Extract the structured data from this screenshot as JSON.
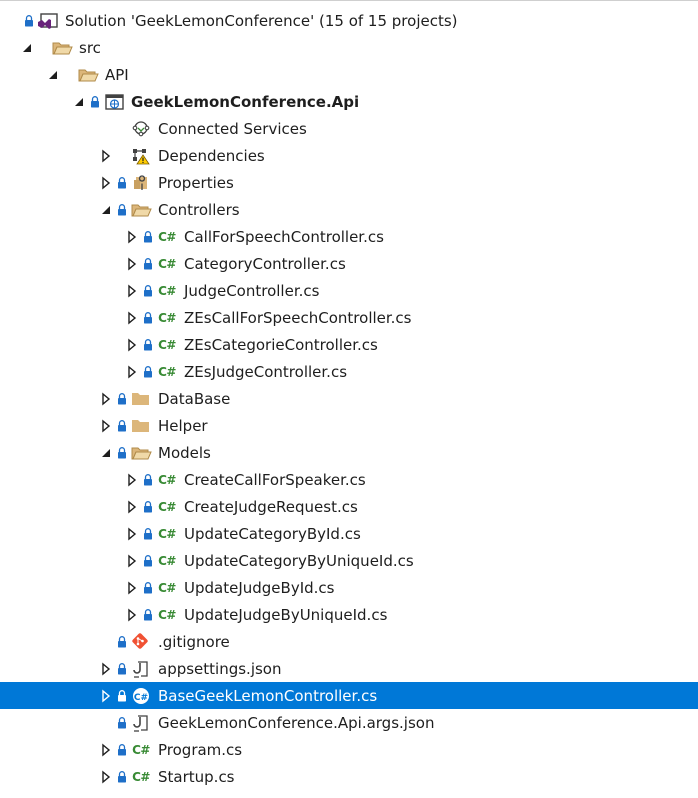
{
  "colors": {
    "selection": "#0078d7",
    "folder_fill": "#dcb67a",
    "csharp_green": "#388a34",
    "lock_blue": "#1e6fc8",
    "git_red": "#f05133",
    "solution_purple": "#68217a"
  },
  "csharp_glyph": "C#",
  "tree": [
    {
      "label": "Solution 'GeekLemonConference' (15 of 15 projects)",
      "level": 0,
      "expander": "none",
      "lock": true,
      "icon": "solution-icon"
    },
    {
      "label": "src",
      "level": 1,
      "expander": "expanded",
      "lock": false,
      "icon": "folder-open-icon"
    },
    {
      "label": "API",
      "level": 2,
      "expander": "expanded",
      "lock": false,
      "icon": "folder-open-icon"
    },
    {
      "label": "GeekLemonConference.Api",
      "level": 3,
      "expander": "expanded",
      "lock": true,
      "icon": "web-project-icon",
      "bold": true
    },
    {
      "label": "Connected Services",
      "level": 4,
      "expander": "none",
      "lock": false,
      "icon": "connected-services-icon"
    },
    {
      "label": "Dependencies",
      "level": 4,
      "expander": "collapsed",
      "lock": false,
      "icon": "dependencies-icon"
    },
    {
      "label": "Properties",
      "level": 4,
      "expander": "collapsed",
      "lock": true,
      "icon": "properties-icon"
    },
    {
      "label": "Controllers",
      "level": 4,
      "expander": "expanded",
      "lock": true,
      "icon": "folder-open-icon"
    },
    {
      "label": "CallForSpeechController.cs",
      "level": 5,
      "expander": "collapsed",
      "lock": true,
      "icon": "csharp-file-icon"
    },
    {
      "label": "CategoryController.cs",
      "level": 5,
      "expander": "collapsed",
      "lock": true,
      "icon": "csharp-file-icon"
    },
    {
      "label": "JudgeController.cs",
      "level": 5,
      "expander": "collapsed",
      "lock": true,
      "icon": "csharp-file-icon"
    },
    {
      "label": "ZEsCallForSpeechController.cs",
      "level": 5,
      "expander": "collapsed",
      "lock": true,
      "icon": "csharp-file-icon"
    },
    {
      "label": "ZEsCategorieController.cs",
      "level": 5,
      "expander": "collapsed",
      "lock": true,
      "icon": "csharp-file-icon"
    },
    {
      "label": "ZEsJudgeController.cs",
      "level": 5,
      "expander": "collapsed",
      "lock": true,
      "icon": "csharp-file-icon"
    },
    {
      "label": "DataBase",
      "level": 4,
      "expander": "collapsed",
      "lock": true,
      "icon": "folder-closed-icon"
    },
    {
      "label": "Helper",
      "level": 4,
      "expander": "collapsed",
      "lock": true,
      "icon": "folder-closed-icon"
    },
    {
      "label": "Models",
      "level": 4,
      "expander": "expanded",
      "lock": true,
      "icon": "folder-open-icon"
    },
    {
      "label": "CreateCallForSpeaker.cs",
      "level": 5,
      "expander": "collapsed",
      "lock": true,
      "icon": "csharp-file-icon"
    },
    {
      "label": "CreateJudgeRequest.cs",
      "level": 5,
      "expander": "collapsed",
      "lock": true,
      "icon": "csharp-file-icon"
    },
    {
      "label": "UpdateCategoryById.cs",
      "level": 5,
      "expander": "collapsed",
      "lock": true,
      "icon": "csharp-file-icon"
    },
    {
      "label": "UpdateCategoryByUniqueId.cs",
      "level": 5,
      "expander": "collapsed",
      "lock": true,
      "icon": "csharp-file-icon"
    },
    {
      "label": "UpdateJudgeById.cs",
      "level": 5,
      "expander": "collapsed",
      "lock": true,
      "icon": "csharp-file-icon"
    },
    {
      "label": "UpdateJudgeByUniqueId.cs",
      "level": 5,
      "expander": "collapsed",
      "lock": true,
      "icon": "csharp-file-icon"
    },
    {
      "label": ".gitignore",
      "level": 4,
      "expander": "none",
      "lock": true,
      "icon": "git-icon"
    },
    {
      "label": "appsettings.json",
      "level": 4,
      "expander": "collapsed",
      "lock": true,
      "icon": "json-file-icon"
    },
    {
      "label": "BaseGeekLemonController.cs",
      "level": 4,
      "expander": "collapsed",
      "lock": true,
      "icon": "csharp-file-added-icon",
      "selected": true
    },
    {
      "label": "GeekLemonConference.Api.args.json",
      "level": 4,
      "expander": "none",
      "lock": true,
      "icon": "json-file-icon"
    },
    {
      "label": "Program.cs",
      "level": 4,
      "expander": "collapsed",
      "lock": true,
      "icon": "csharp-file-icon"
    },
    {
      "label": "Startup.cs",
      "level": 4,
      "expander": "collapsed",
      "lock": true,
      "icon": "csharp-file-icon"
    }
  ]
}
